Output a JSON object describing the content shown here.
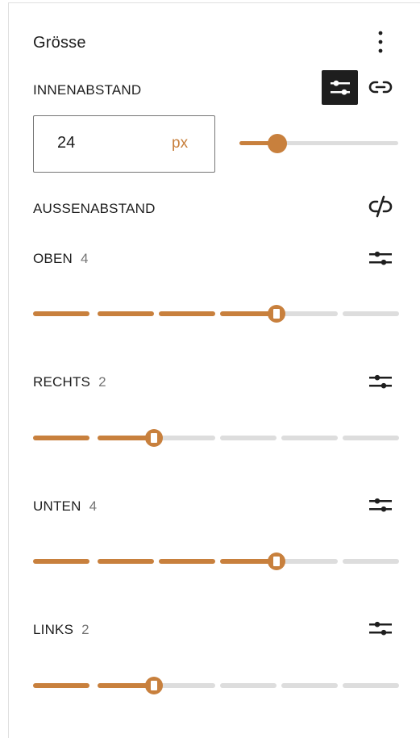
{
  "panel": {
    "title": "Grösse",
    "menu_icon": "more-vertical-icon"
  },
  "padding": {
    "label": "INNENABSTAND",
    "value": "24",
    "unit": "px",
    "slider_fraction": 0.24,
    "custom_icon": "sliders-icon",
    "link_icon": "link-icon"
  },
  "margin": {
    "label": "AUSSENABSTAND",
    "unlink_icon": "link-off-icon",
    "sides": [
      {
        "label": "OBEN",
        "value": "4",
        "level": 4
      },
      {
        "label": "RECHTS",
        "value": "2",
        "level": 2
      },
      {
        "label": "UNTEN",
        "value": "4",
        "level": 4
      },
      {
        "label": "LINKS",
        "value": "2",
        "level": 2
      }
    ],
    "steps": 6
  },
  "colors": {
    "accent": "#c8803d",
    "track": "#dddddd",
    "text": "#1e1e1e",
    "muted": "#757575"
  }
}
